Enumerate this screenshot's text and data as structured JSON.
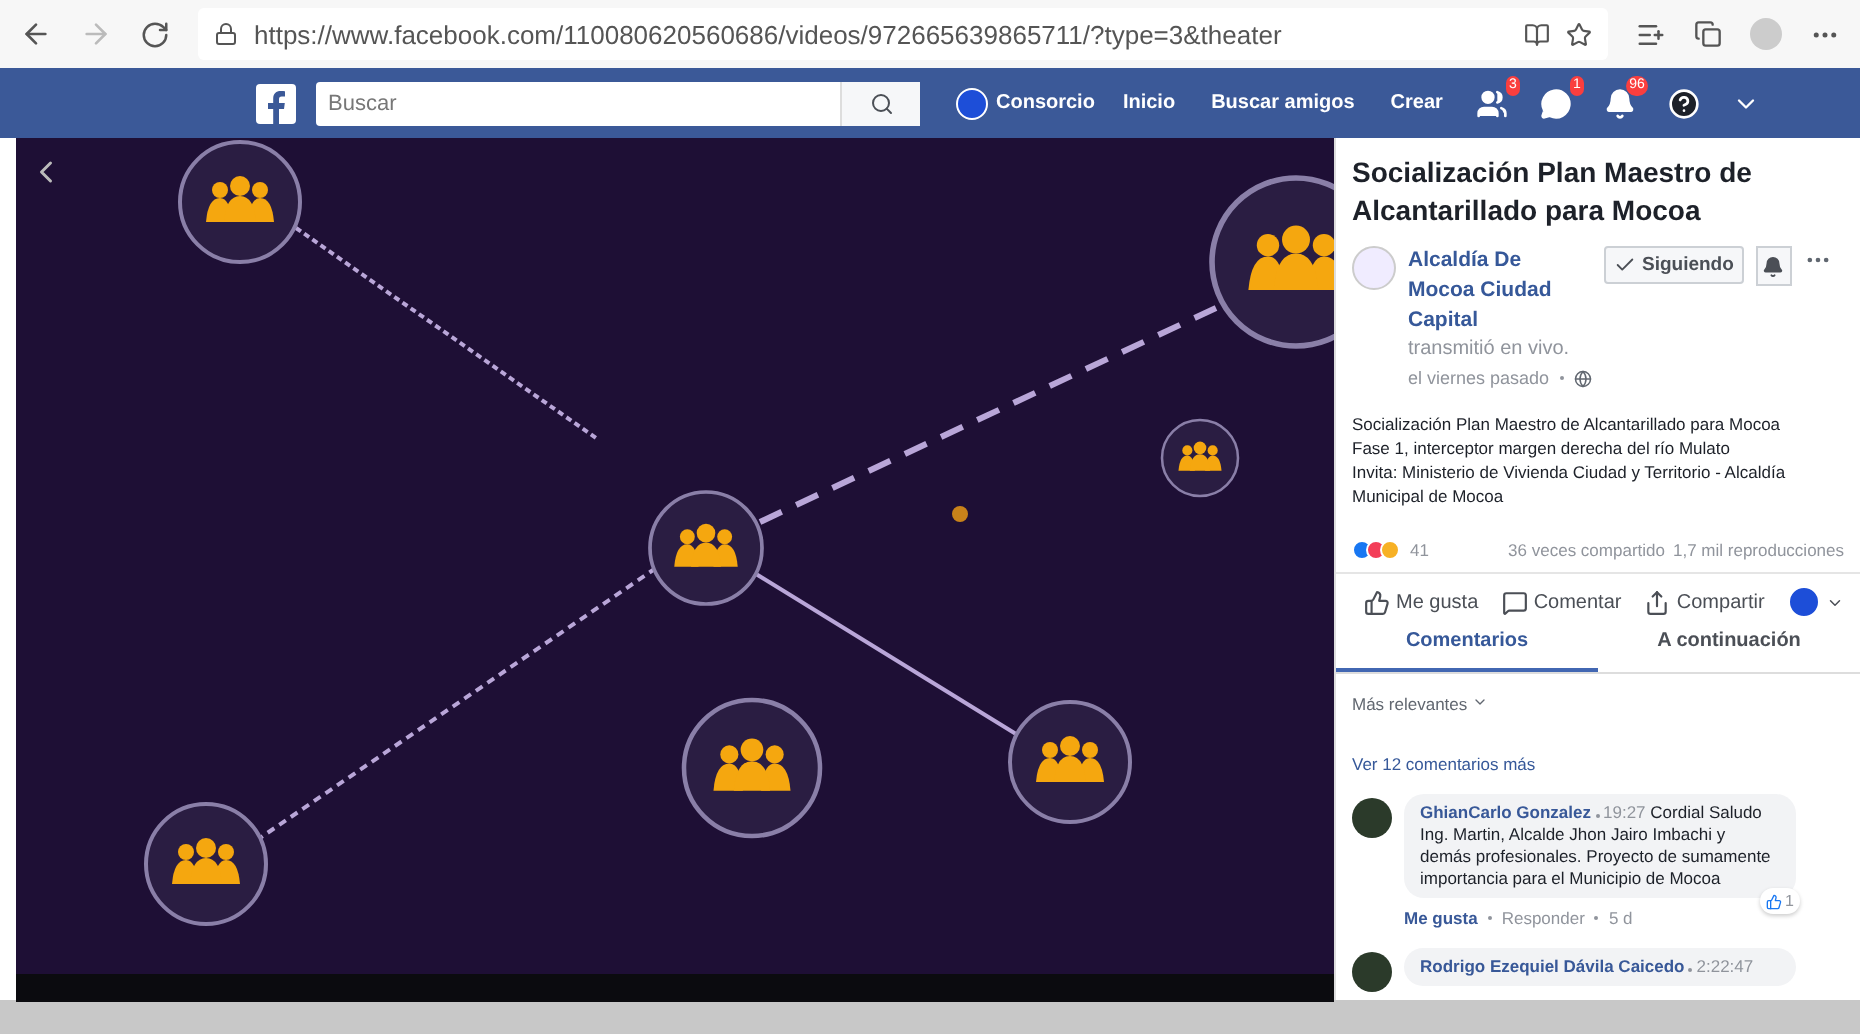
{
  "browser": {
    "url": "https://www.facebook.com/110080620560686/videos/972665639865711/?type=3&theater"
  },
  "top_bar": {
    "search": {
      "placeholder": "Buscar"
    },
    "profile": "Consorcio",
    "links": [
      "Inicio",
      "Buscar amigos",
      "Crear"
    ],
    "notifications": [
      {
        "kind": "friends",
        "badge": "3"
      },
      {
        "kind": "messages",
        "badge": "1"
      },
      {
        "kind": "alerts",
        "badge": "96"
      }
    ]
  },
  "post": {
    "title": "Socialización Plan Maestro de Alcantarillado para Mocoa",
    "page_name": "Alcaldía De Mocoa Ciudad Capital",
    "action": "transmitió en vivo.",
    "time": "el viernes pasado",
    "follow_button": "Siguiendo",
    "description": [
      "Socialización Plan Maestro de Alcantarillado para Mocoa",
      "Fase 1, interceptor margen derecha del río Mulato",
      "Invita: Ministerio de Vivienda Ciudad y Territorio - Alcaldía Municipal de Mocoa"
    ],
    "reaction_count": "41",
    "shares": "36 veces compartido",
    "views": "1,7 mil reproducciones",
    "actions": [
      "Me gusta",
      "Comentar",
      "Compartir"
    ],
    "tabs": [
      {
        "label": "Comentarios",
        "selected": true
      },
      {
        "label": "A continuación",
        "selected": false
      }
    ],
    "sort": "Más relevantes",
    "more_comments": "Ver 12 comentarios más",
    "comments": [
      {
        "author": "GhianCarlo Gonzalez",
        "time": "19:27",
        "text": "Cordial Saludo Ing. Martin, Alcalde Jhon Jairo Imbachi y demás profesionales. Proyecto de sumamente importancia para el Municipio de Mocoa",
        "like": "Me gusta",
        "reply": "Responder",
        "age": "5 d",
        "likes": "1"
      },
      {
        "author": "Rodrigo Ezequiel Dávila Caicedo",
        "time": "2:22:47"
      }
    ]
  }
}
